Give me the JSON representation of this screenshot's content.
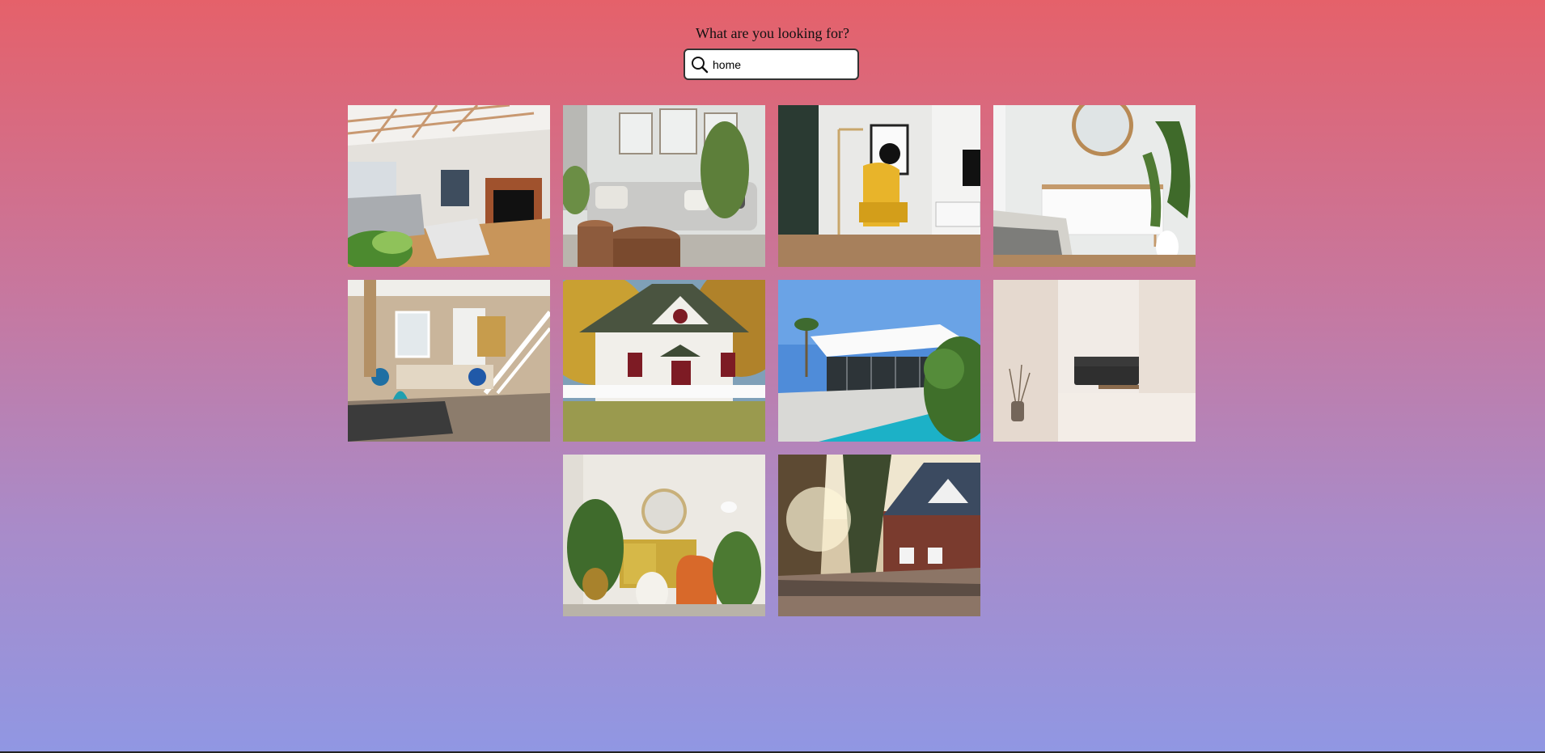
{
  "search": {
    "prompt": "What are you looking for?",
    "value": "home"
  },
  "results": [
    {
      "subject": "living room with fireplace"
    },
    {
      "subject": "grey sofa with round tables"
    },
    {
      "subject": "yellow armchair and floor lamp"
    },
    {
      "subject": "bedroom with white dresser and mirror"
    },
    {
      "subject": "open living room with blue chairs and stairs"
    },
    {
      "subject": "white house with picket fence"
    },
    {
      "subject": "modern house with pool"
    },
    {
      "subject": "minimal room with black sofa"
    },
    {
      "subject": "orange armchair and yellow cabinet"
    },
    {
      "subject": "brick house in forest"
    }
  ],
  "colors": {
    "gradient_top": "#e5616a",
    "gradient_bottom": "#9097e3"
  }
}
